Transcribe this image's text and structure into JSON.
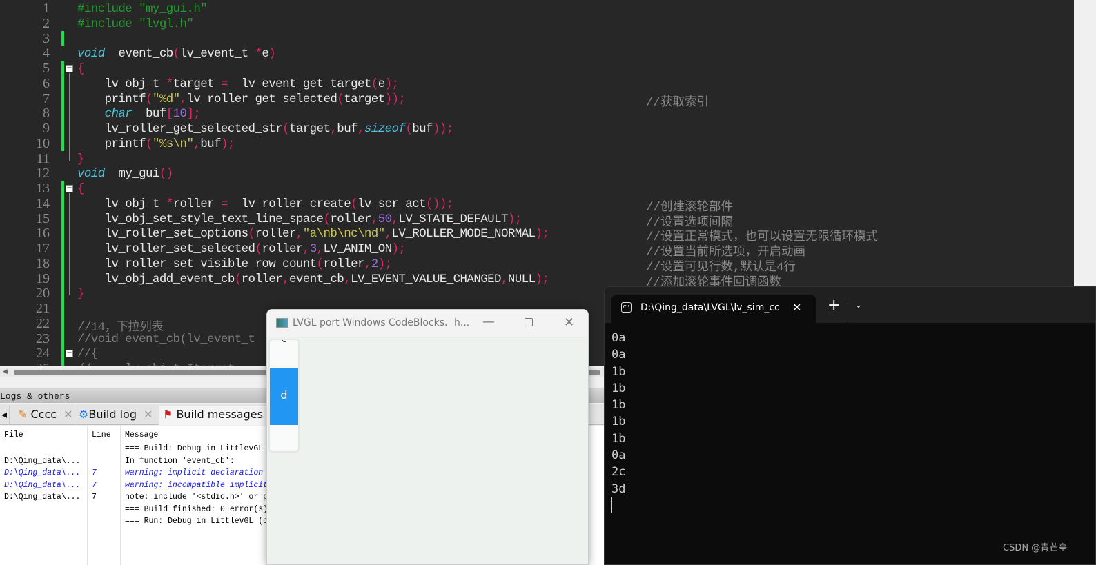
{
  "editor": {
    "lines": [
      [
        [
          "t-inc",
          "#include \"my_gui.h\""
        ]
      ],
      [
        [
          "t-inc",
          "#include \"lvgl.h\""
        ]
      ],
      [],
      [
        [
          "t-kw",
          "void"
        ],
        [
          "",
          "  event_cb"
        ],
        [
          "t-p",
          "("
        ],
        [
          "",
          "lv_event_t "
        ],
        [
          "t-p",
          "*"
        ],
        [
          "",
          "e"
        ],
        [
          "t-p",
          ")"
        ]
      ],
      [
        [
          "t-p",
          "{"
        ]
      ],
      [
        [
          "",
          "    lv_obj_t "
        ],
        [
          "t-p",
          "*"
        ],
        [
          "",
          "target "
        ],
        [
          "t-p",
          "="
        ],
        [
          "",
          "  lv_event_get_target"
        ],
        [
          "t-p",
          "("
        ],
        [
          "",
          "e"
        ],
        [
          "t-p",
          ");"
        ]
      ],
      [
        [
          "",
          "    printf"
        ],
        [
          "t-p",
          "("
        ],
        [
          "t-s",
          "\"%d\""
        ],
        [
          "t-p",
          ","
        ],
        [
          "",
          "lv_roller_get_selected"
        ],
        [
          "t-p",
          "("
        ],
        [
          "",
          "target"
        ],
        [
          "t-p",
          "));"
        ]
      ],
      [
        [
          "t-kw",
          "    char"
        ],
        [
          "",
          "  buf"
        ],
        [
          "t-p",
          "["
        ],
        [
          "t-n",
          "10"
        ],
        [
          "t-p",
          "];"
        ]
      ],
      [
        [
          "",
          "    lv_roller_get_selected_str"
        ],
        [
          "t-p",
          "("
        ],
        [
          "",
          "target"
        ],
        [
          "t-p",
          ","
        ],
        [
          "",
          "buf"
        ],
        [
          "t-p",
          ","
        ],
        [
          "t-kw",
          "sizeof"
        ],
        [
          "t-p",
          "("
        ],
        [
          "",
          "buf"
        ],
        [
          "t-p",
          "));"
        ]
      ],
      [
        [
          "",
          "    printf"
        ],
        [
          "t-p",
          "("
        ],
        [
          "t-s",
          "\"%s\\n\""
        ],
        [
          "t-p",
          ","
        ],
        [
          "",
          "buf"
        ],
        [
          "t-p",
          ");"
        ]
      ],
      [
        [
          "t-p",
          "}"
        ]
      ],
      [
        [
          "t-kw",
          "void"
        ],
        [
          "",
          "  my_gui"
        ],
        [
          "t-p",
          "()"
        ]
      ],
      [
        [
          "t-p",
          "{"
        ]
      ],
      [
        [
          "",
          "    lv_obj_t "
        ],
        [
          "t-p",
          "*"
        ],
        [
          "",
          "roller "
        ],
        [
          "t-p",
          "="
        ],
        [
          "",
          "  lv_roller_create"
        ],
        [
          "t-p",
          "("
        ],
        [
          "",
          "lv_scr_act"
        ],
        [
          "t-p",
          "());"
        ]
      ],
      [
        [
          "",
          "    lv_obj_set_style_text_line_space"
        ],
        [
          "t-p",
          "("
        ],
        [
          "",
          "roller"
        ],
        [
          "t-p",
          ","
        ],
        [
          "t-n",
          "50"
        ],
        [
          "t-p",
          ","
        ],
        [
          "",
          "LV_STATE_DEFAULT"
        ],
        [
          "t-p",
          ");"
        ]
      ],
      [
        [
          "",
          "    lv_roller_set_options"
        ],
        [
          "t-p",
          "("
        ],
        [
          "",
          "roller"
        ],
        [
          "t-p",
          ","
        ],
        [
          "t-s",
          "\"a\\nb\\nc\\nd\""
        ],
        [
          "t-p",
          ","
        ],
        [
          "",
          "LV_ROLLER_MODE_NORMAL"
        ],
        [
          "t-p",
          ");"
        ]
      ],
      [
        [
          "",
          "    lv_roller_set_selected"
        ],
        [
          "t-p",
          "("
        ],
        [
          "",
          "roller"
        ],
        [
          "t-p",
          ","
        ],
        [
          "t-n",
          "3"
        ],
        [
          "t-p",
          ","
        ],
        [
          "",
          "LV_ANIM_ON"
        ],
        [
          "t-p",
          ");"
        ]
      ],
      [
        [
          "",
          "    lv_roller_set_visible_row_count"
        ],
        [
          "t-p",
          "("
        ],
        [
          "",
          "roller"
        ],
        [
          "t-p",
          ","
        ],
        [
          "t-n",
          "2"
        ],
        [
          "t-p",
          ");"
        ]
      ],
      [
        [
          "",
          "    lv_obj_add_event_cb"
        ],
        [
          "t-p",
          "("
        ],
        [
          "",
          "roller"
        ],
        [
          "t-p",
          ","
        ],
        [
          "",
          "event_cb"
        ],
        [
          "t-p",
          ","
        ],
        [
          "",
          "LV_EVENT_VALUE_CHANGED"
        ],
        [
          "t-p",
          ","
        ],
        [
          "",
          "NULL"
        ],
        [
          "t-p",
          ");"
        ]
      ],
      [
        [
          "t-p",
          "}"
        ]
      ],
      [],
      [
        [
          "t-c",
          "//14，下拉列表"
        ]
      ],
      [
        [
          "t-c",
          "//void event_cb(lv_event_t"
        ]
      ],
      [
        [
          "t-c",
          "//{"
        ]
      ],
      [
        [
          "t-c",
          "//     lv_obj_t *target"
        ]
      ]
    ],
    "comments": {
      "7": "//获取索引",
      "14": "//创建滚轮部件",
      "15": "//设置选项间隔",
      "16": "//设置正常模式，也可以设置无限循环模式",
      "17": "//设置当前所选项，开启动画",
      "18": "//设置可见行数,默认是4行",
      "19": "//添加滚轮事件回调函数"
    }
  },
  "panel": {
    "title": "Logs & others",
    "tabs": [
      {
        "label": "Cccc",
        "icon": "pencil-icon"
      },
      {
        "label": "Build log",
        "icon": "gear-icon"
      },
      {
        "label": "Build messages",
        "icon": "flag-icon"
      }
    ],
    "columns": [
      "File",
      "Line",
      "Message"
    ],
    "rows": [
      {
        "file": "",
        "line": "",
        "msg": "=== Build: Debug in LittlevGL",
        "warn": false
      },
      {
        "file": "D:\\Qing_data\\...",
        "line": "",
        "msg": "In function 'event_cb':",
        "warn": false
      },
      {
        "file": "D:\\Qing_data\\...",
        "line": "7",
        "msg": "warning: implicit declaration",
        "warn": true
      },
      {
        "file": "D:\\Qing_data\\...",
        "line": "7",
        "msg": "warning: incompatible implicit",
        "warn": true
      },
      {
        "file": "D:\\Qing_data\\...",
        "line": "7",
        "msg": "note: include '<stdio.h>' or p",
        "warn": false
      },
      {
        "file": "",
        "line": "",
        "msg": "=== Build finished: 0 error(s)",
        "warn": false
      },
      {
        "file": "",
        "line": "",
        "msg": "=== Run: Debug in LittlevGL (c",
        "warn": false
      }
    ]
  },
  "lvgl_window": {
    "title": "LVGL port Windows CodeBlocks.",
    "title_suffix": "h...",
    "roller": {
      "partial_option": "c",
      "selected": "d"
    },
    "accent": "#2196f3"
  },
  "terminal": {
    "tab_title": "D:\\Qing_data\\LVGL\\lv_sim_co",
    "output": [
      "0a",
      "0a",
      "1b",
      "1b",
      "1b",
      "1b",
      "1b",
      "0a",
      "2c",
      "3d"
    ]
  },
  "watermark": "CSDN @青芒亭"
}
